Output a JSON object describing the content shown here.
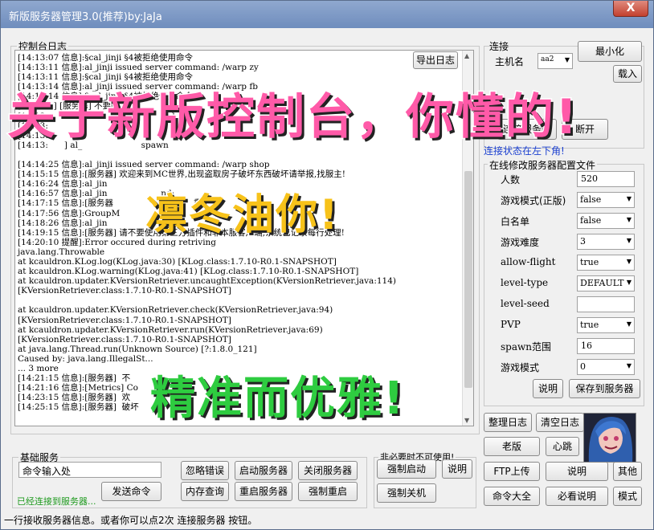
{
  "window": {
    "title": "新版服务器管理3.0(推荐)by:JaJa",
    "close": "X"
  },
  "console": {
    "group_label": "控制台日志",
    "export_button": "导出日志",
    "lines": [
      "[14:13:07 信息]:§cal_jinji §4被拒绝使用命令",
      "[14:13:11 信息]:al_jinji issued server command: /warp zy",
      "[14:13:11 信息]:§cal_jinji §4被拒绝使用命令",
      "[14:13:14 信息]:al_jinji issued server command: /warp fb",
      "[14:13:14 信息]:§cal_jinji §4被拒绝使用命令",
      "[14:13:  ] [服务器] 不要购...",
      "[14:13:                                              ]",
      "[14:13:",
      "[14:13:",
      "[14:13:      ] al_                      spawn",
      "",
      "[14:14:25 信息]:al_jinji issued server command: /warp shop",
      "[14:15:15 信息]:[服务器] 欢迎来到MC世界,出现盗取房子破坏东西破坏请举报,找服主!",
      "[14:16:24 信息]:al_jin",
      "[14:16:57 信息]:al_jin                    nd:",
      "[14:17:15 信息]:[服务器                              重!",
      "[14:17:56 信息]:GroupM",
      "[14:18:26 信息]:al_jin",
      "[14:19:15 信息]:[服务器] 请不要使用第三方插件和非本服客户端,系统已记录每行处理!",
      "[14:20:10 提醒]:Error occured during retriving",
      "java.lang.Throwable",
      "at kcauldron.KLog.log(KLog.java:30) [KLog.class:1.7.10-R0.1-SNAPSHOT]",
      "at kcauldron.KLog.warning(KLog.java:41) [KLog.class:1.7.10-R0.1-SNAPSHOT]",
      "at kcauldron.updater.KVersionRetriever.uncaughtException(KVersionRetriever.java:114)",
      "[KVersionRetriever.class:1.7.10-R0.1-SNAPSHOT]",
      "",
      "at kcauldron.updater.KVersionRetriever.check(KVersionRetriever.java:94)",
      "[KVersionRetriever.class:1.7.10-R0.1-SNAPSHOT]",
      "at kcauldron.updater.KVersionRetriever.run(KVersionRetriever.java:69)",
      "[KVersionRetriever.class:1.7.10-R0.1-SNAPSHOT]",
      "at java.lang.Thread.run(Unknown Source) [?:1.8.0_121]",
      "Caused by: java.lang.IllegalSt...",
      "... 3 more",
      "[14:21:15 信息]:[服务器]  不",
      "[14:21:16 信息]:[Metrics] Co",
      "[14:23:15 信息]:[服务器]  欢",
      "[14:25:15 信息]:[服务器]  破坏"
    ]
  },
  "connection": {
    "group_label": "连接",
    "host_label": "主机名",
    "host_value": "aa2",
    "minimize_button": "最小化",
    "load_button": "载入",
    "connect_button": "连接服务器",
    "disconnect_button": "断开",
    "status_hint": "连接状态在左下角!"
  },
  "config": {
    "group_label": "在线修改服务器配置文件",
    "rows": [
      {
        "label": "人数",
        "kind": "text",
        "value": "520"
      },
      {
        "label": "游戏模式(正版)",
        "kind": "select",
        "value": "false"
      },
      {
        "label": "白名单",
        "kind": "select",
        "value": "false"
      },
      {
        "label": "游戏难度",
        "kind": "select",
        "value": "3"
      },
      {
        "label": "allow-flight",
        "kind": "select",
        "value": "true"
      },
      {
        "label": "level-type",
        "kind": "select",
        "value": "DEFAULT"
      },
      {
        "label": "level-seed",
        "kind": "text",
        "value": ""
      },
      {
        "label": "PVP",
        "kind": "select",
        "value": "true"
      },
      {
        "label": "spawn范围",
        "kind": "text",
        "value": "16"
      },
      {
        "label": "游戏模式",
        "kind": "select",
        "value": "0"
      }
    ],
    "explain_button": "说明",
    "save_button": "保存到服务器"
  },
  "tools": {
    "tidy_log": "整理日志",
    "clear_log": "清空日志",
    "old_version": "老版",
    "heartbeat": "心跳",
    "ftp_upload": "FTP上传",
    "explain": "说明",
    "other": "其他",
    "command_list": "命令大全",
    "must_read": "必看说明",
    "mode": "模式"
  },
  "basic": {
    "group_label": "基础服务",
    "command_placeholder": "命令输入处",
    "send_button": "发送命令",
    "ignore_error": "忽略错误",
    "start_server": "启动服务器",
    "stop_server": "关闭服务器",
    "memory_query": "内存查询",
    "restart_server": "重启服务器",
    "force_restart": "强制重启",
    "connected_status": "已经连接到服务器..."
  },
  "force": {
    "group_label": "非必要时不可使用!",
    "force_start": "强制启动",
    "explain": "说明",
    "force_shutdown": "强制关机"
  },
  "statusbar": {
    "text": "一行接收服务器信息。或者你可以点2次 连接服务器 按钮。"
  },
  "overlays": {
    "headline": "关于新版控制台，你懂的!",
    "cheer": "凛冬油你!",
    "tagline": "精准而优雅!"
  }
}
